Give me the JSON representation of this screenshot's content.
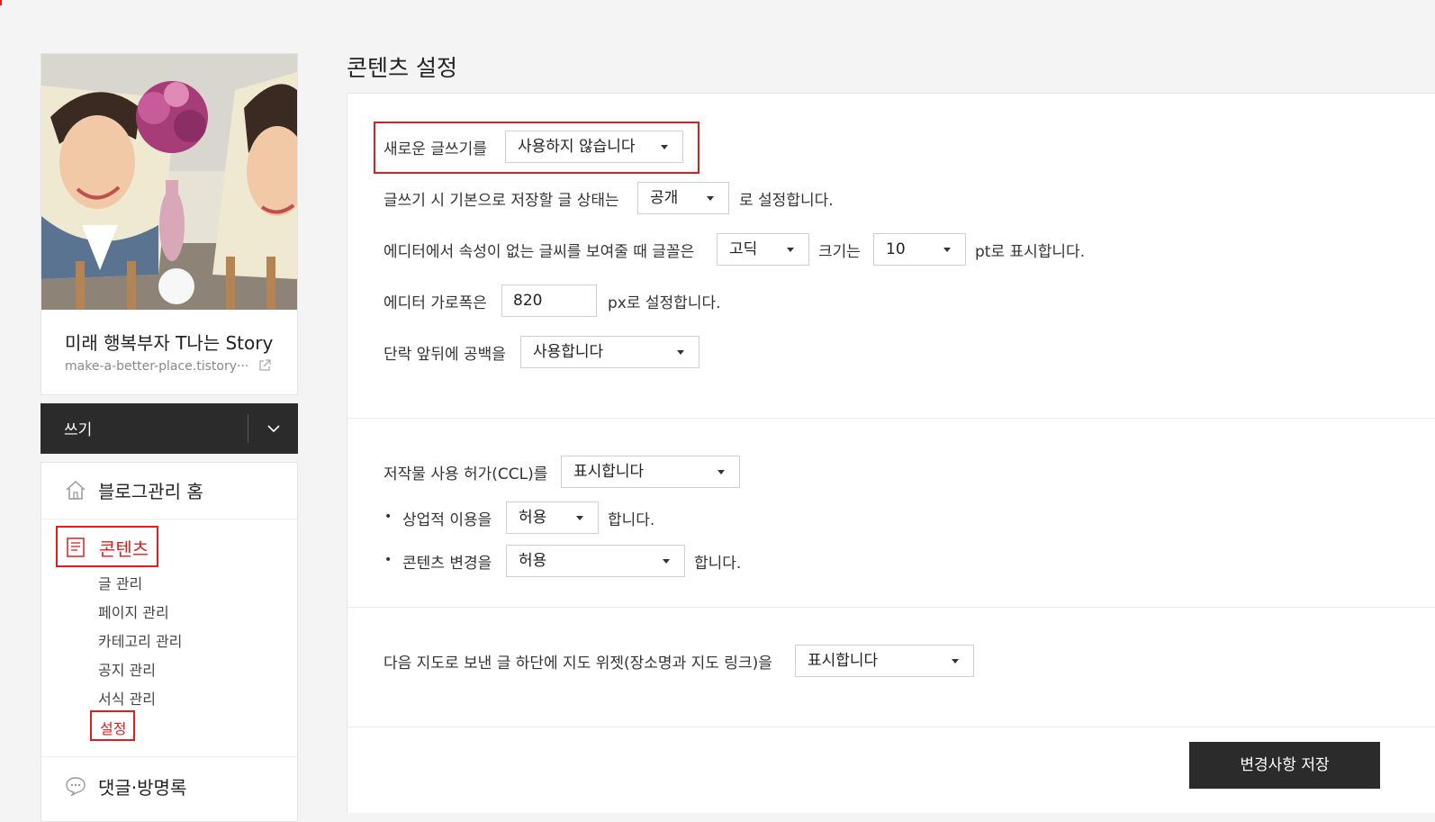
{
  "sidebar": {
    "blog_title": "미래 행복부자 T나는 Story",
    "blog_url": "make-a-better-place.tistory···",
    "write_label": "쓰기",
    "menu": {
      "home_label": "블로그관리 홈",
      "contents_label": "콘텐츠",
      "sub_items": [
        "글 관리",
        "페이지 관리",
        "카테고리 관리",
        "공지 관리",
        "서식 관리"
      ],
      "active_sub": "설정",
      "comments_label": "댓글·방명록"
    }
  },
  "main": {
    "page_title": "콘텐츠 설정",
    "new_editor": {
      "label": "새로운 글쓰기를",
      "value": "사용하지 않습니다"
    },
    "default_status": {
      "label_before": "글쓰기 시 기본으로 저장할 글 상태는",
      "value": "공개",
      "label_after": "로 설정합니다."
    },
    "font": {
      "label_before": "에디터에서 속성이 없는 글씨를 보여줄 때 글꼴은",
      "font_value": "고딕",
      "size_label": "크기는",
      "size_value": "10",
      "label_after": "pt로 표시합니다."
    },
    "editor_width": {
      "label": "에디터 가로폭은",
      "value": "820",
      "label_after": "px로 설정합니다."
    },
    "paragraph_spacing": {
      "label": "단락 앞뒤에 공백을",
      "value": "사용합니다"
    },
    "ccl": {
      "label": "저작물 사용 허가(CCL)를",
      "value": "표시합니다",
      "commercial_label": "상업적 이용을",
      "commercial_value": "허용",
      "commercial_after": "합니다.",
      "modify_label": "콘텐츠 변경을",
      "modify_value": "허용",
      "modify_after": "합니다.",
      "bullet": "•"
    },
    "map": {
      "label": "다음 지도로 보낸 글 하단에 지도 위젯(장소명과 지도 링크)을",
      "value": "표시합니다"
    },
    "save_label": "변경사항 저장"
  },
  "colors": {
    "accent_red": "#e01e1e",
    "dark_button": "#2b2b2b"
  }
}
